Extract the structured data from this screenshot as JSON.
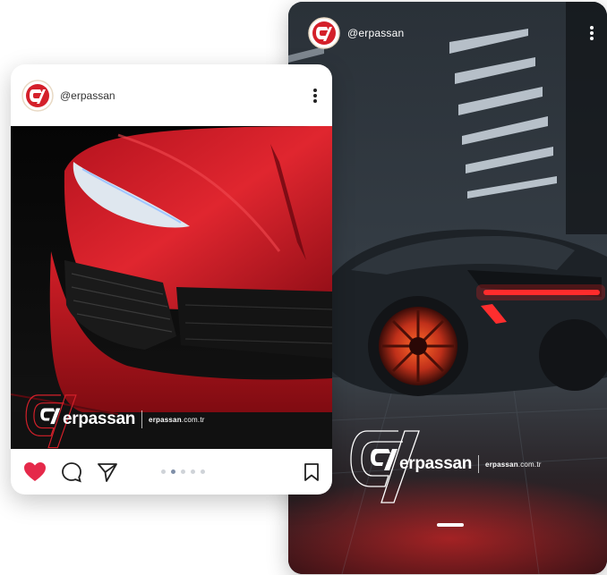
{
  "story": {
    "username": "@erpassan",
    "brand_name": "erpassan",
    "brand_url_main": "erpassan",
    "brand_url_tld": ".com.tr"
  },
  "post": {
    "username": "@erpassan",
    "brand_name": "erpassan",
    "brand_url_main": "erpassan",
    "brand_url_tld": ".com.tr",
    "carousel": {
      "count": 5,
      "active": 1
    }
  },
  "colors": {
    "brand_red": "#d4202a",
    "like_red": "#e5294a",
    "dot_active": "#7f8fa8",
    "dot_inactive": "#cfd3d8"
  },
  "icons": {
    "like": "heart-icon",
    "comment": "comment-bubble-icon",
    "share": "paper-plane-icon",
    "save": "bookmark-icon",
    "menu": "more-vertical-icon"
  }
}
